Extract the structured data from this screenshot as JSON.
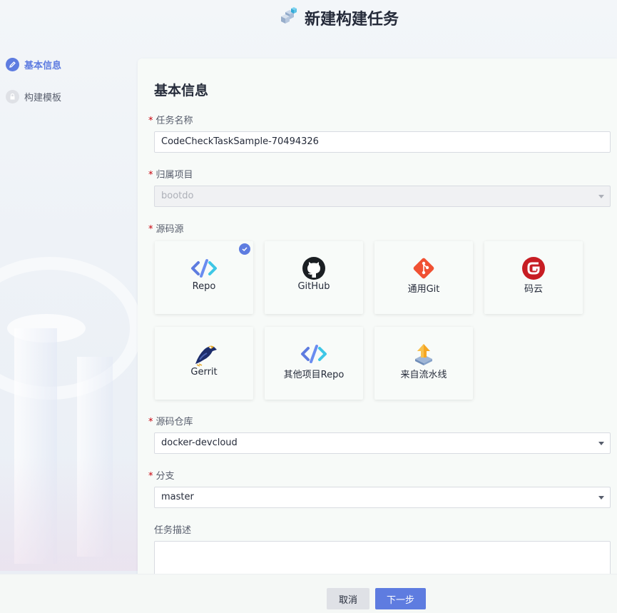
{
  "header": {
    "title": "新建构建任务",
    "icon": "cubes-icon"
  },
  "steps": [
    {
      "label": "基本信息",
      "state": "active",
      "icon": "pencil-icon"
    },
    {
      "label": "构建模板",
      "state": "inactive",
      "icon": "lock-icon"
    }
  ],
  "form": {
    "section_title": "基本信息",
    "task_name": {
      "label": "任务名称",
      "value": "CodeCheckTaskSample-70494326"
    },
    "project": {
      "label": "归属项目",
      "value": "bootdo"
    },
    "source": {
      "label": "源码源",
      "options": [
        {
          "label": "Repo",
          "icon": "repo-icon",
          "selected": true
        },
        {
          "label": "GitHub",
          "icon": "github-icon",
          "selected": false
        },
        {
          "label": "通用Git",
          "icon": "git-icon",
          "selected": false
        },
        {
          "label": "码云",
          "icon": "gitee-icon",
          "selected": false
        },
        {
          "label": "Gerrit",
          "icon": "gerrit-icon",
          "selected": false
        },
        {
          "label": "其他项目Repo",
          "icon": "repo-icon",
          "selected": false
        },
        {
          "label": "来自流水线",
          "icon": "pipeline-icon",
          "selected": false
        }
      ]
    },
    "repository": {
      "label": "源码仓库",
      "value": "docker-devcloud"
    },
    "branch": {
      "label": "分支",
      "value": "master"
    },
    "description": {
      "label": "任务描述",
      "value": ""
    }
  },
  "footer": {
    "cancel_label": "取消",
    "next_label": "下一步"
  },
  "colors": {
    "accent": "#5e7ce0",
    "required": "#c7000b"
  }
}
